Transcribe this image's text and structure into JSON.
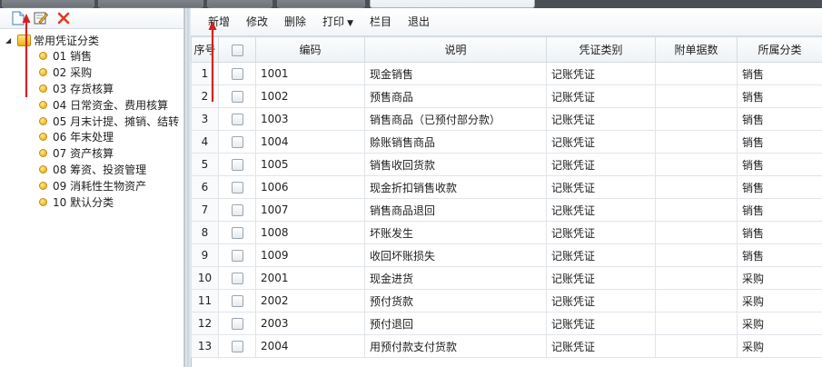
{
  "left_toolbar": {
    "icons": [
      "new-document-icon",
      "edit-icon",
      "delete-icon"
    ]
  },
  "tree": {
    "root_label": "常用凭证分类",
    "items": [
      "01 销售",
      "02 采购",
      "03 存货核算",
      "04 日常资金、费用核算",
      "05 月末计提、摊销、结转",
      "06 年末处理",
      "07 资产核算",
      "08 筹资、投资管理",
      "09 消耗性生物资产",
      "10 默认分类"
    ]
  },
  "toolbar": {
    "new_label": "新增",
    "edit_label": "修改",
    "delete_label": "删除",
    "print_label": "打印",
    "columns_label": "栏目",
    "exit_label": "退出"
  },
  "table": {
    "headers": [
      "序号",
      "",
      "编码",
      "说明",
      "凭证类别",
      "附单据数",
      "所属分类"
    ],
    "rows": [
      {
        "idx": "1",
        "code": "1001",
        "desc": "现金销售",
        "type": "记账凭证",
        "attachments": "",
        "category": "销售"
      },
      {
        "idx": "2",
        "code": "1002",
        "desc": "预售商品",
        "type": "记账凭证",
        "attachments": "",
        "category": "销售"
      },
      {
        "idx": "3",
        "code": "1003",
        "desc": "销售商品（已预付部分款）",
        "type": "记账凭证",
        "attachments": "",
        "category": "销售"
      },
      {
        "idx": "4",
        "code": "1004",
        "desc": "赊账销售商品",
        "type": "记账凭证",
        "attachments": "",
        "category": "销售"
      },
      {
        "idx": "5",
        "code": "1005",
        "desc": "销售收回货款",
        "type": "记账凭证",
        "attachments": "",
        "category": "销售"
      },
      {
        "idx": "6",
        "code": "1006",
        "desc": "现金折扣销售收款",
        "type": "记账凭证",
        "attachments": "",
        "category": "销售"
      },
      {
        "idx": "7",
        "code": "1007",
        "desc": "销售商品退回",
        "type": "记账凭证",
        "attachments": "",
        "category": "销售"
      },
      {
        "idx": "8",
        "code": "1008",
        "desc": "坏账发生",
        "type": "记账凭证",
        "attachments": "",
        "category": "销售"
      },
      {
        "idx": "9",
        "code": "1009",
        "desc": "收回坏账损失",
        "type": "记账凭证",
        "attachments": "",
        "category": "销售"
      },
      {
        "idx": "10",
        "code": "2001",
        "desc": "现金进货",
        "type": "记账凭证",
        "attachments": "",
        "category": "采购"
      },
      {
        "idx": "11",
        "code": "2002",
        "desc": "预付货款",
        "type": "记账凭证",
        "attachments": "",
        "category": "采购"
      },
      {
        "idx": "12",
        "code": "2003",
        "desc": "预付退回",
        "type": "记账凭证",
        "attachments": "",
        "category": "采购"
      },
      {
        "idx": "13",
        "code": "2004",
        "desc": "用预付款支付货款",
        "type": "记账凭证",
        "attachments": "",
        "category": "采购"
      }
    ]
  },
  "colors": {
    "annotation_arrow": "#d62020",
    "delete_icon": "#e03a1e",
    "splitter": "#c9d2dc"
  }
}
